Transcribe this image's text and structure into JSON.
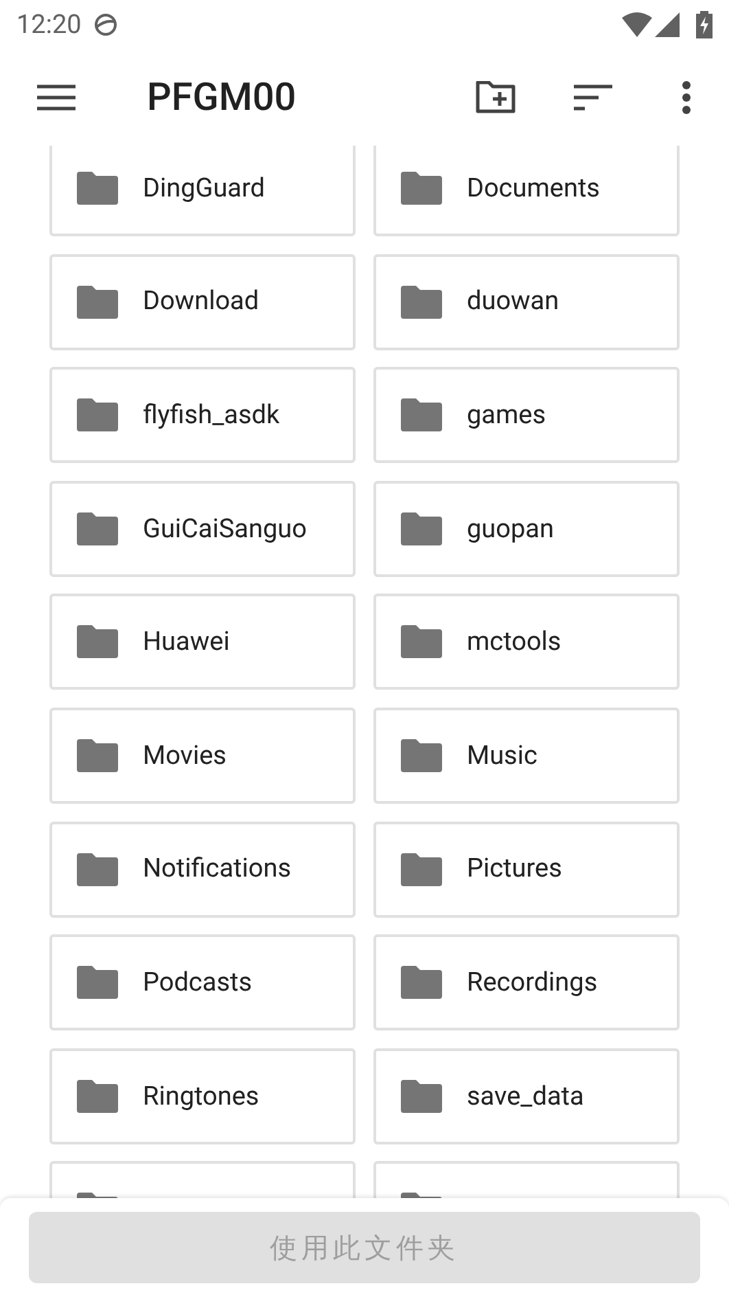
{
  "status_bar": {
    "time": "12:20"
  },
  "toolbar": {
    "title": "PFGM00"
  },
  "folders": [
    {
      "kind": "folder",
      "name": "DingGuard"
    },
    {
      "kind": "folder",
      "name": "Documents"
    },
    {
      "kind": "folder",
      "name": "Download"
    },
    {
      "kind": "folder",
      "name": "duowan"
    },
    {
      "kind": "folder",
      "name": "flyfish_asdk"
    },
    {
      "kind": "folder",
      "name": "games"
    },
    {
      "kind": "folder",
      "name": "GuiCaiSanguo"
    },
    {
      "kind": "folder",
      "name": "guopan"
    },
    {
      "kind": "folder",
      "name": "Huawei"
    },
    {
      "kind": "folder",
      "name": "mctools"
    },
    {
      "kind": "folder",
      "name": "Movies"
    },
    {
      "kind": "folder",
      "name": "Music"
    },
    {
      "kind": "folder",
      "name": "Notifications"
    },
    {
      "kind": "folder",
      "name": "Pictures"
    },
    {
      "kind": "folder",
      "name": "Podcasts"
    },
    {
      "kind": "folder",
      "name": "Recordings"
    },
    {
      "kind": "folder",
      "name": "Ringtones"
    },
    {
      "kind": "folder",
      "name": "save_data"
    },
    {
      "kind": "folder"
    },
    {
      "kind": "folder"
    }
  ],
  "action_button": {
    "label": "使用此文件夹",
    "disabled": true
  }
}
